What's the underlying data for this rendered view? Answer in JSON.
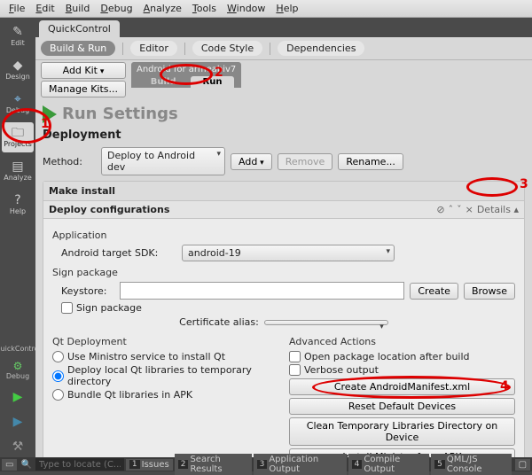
{
  "menu": [
    "File",
    "Edit",
    "Build",
    "Debug",
    "Analyze",
    "Tools",
    "Window",
    "Help"
  ],
  "sidebar": {
    "items": [
      {
        "icon": "✎",
        "label": "Edit"
      },
      {
        "icon": "◆",
        "label": "Design"
      },
      {
        "icon": "🐞",
        "label": "Debug"
      },
      {
        "icon": "🗀",
        "label": "Projects"
      },
      {
        "icon": "📊",
        "label": "Analyze"
      },
      {
        "icon": "?",
        "label": "Help"
      }
    ],
    "project_label": "QuickControl",
    "debug_label": "Debug"
  },
  "tab": "QuickControl",
  "topnav": [
    "Build & Run",
    "Editor",
    "Code Style",
    "Dependencies"
  ],
  "kit": {
    "add": "Add Kit",
    "manage": "Manage Kits...",
    "title": "Android for armeabiv7",
    "modes": [
      "Build",
      "Run"
    ]
  },
  "page_title": "Run Settings",
  "deployment": {
    "heading": "Deployment",
    "method_label": "Method:",
    "method_value": "Deploy to Android dev",
    "add": "Add",
    "remove": "Remove",
    "rename": "Rename..."
  },
  "panel": {
    "make": "Make install",
    "deploy_conf": "Deploy configurations",
    "details": "Details",
    "application": "Application",
    "target_sdk_label": "Android target SDK:",
    "target_sdk_value": "android-19",
    "sign": "Sign package",
    "keystore_label": "Keystore:",
    "create": "Create",
    "browse": "Browse",
    "sign_chk": "Sign package",
    "cert_alias": "Certificate alias:",
    "qt_deploy": "Qt Deployment",
    "qt_opts": [
      "Use Ministro service to install Qt",
      "Deploy local Qt libraries to temporary directory",
      "Bundle Qt libraries in APK"
    ],
    "adv": "Advanced Actions",
    "open_loc": "Open package location after build",
    "verbose": "Verbose output",
    "btns": [
      "Create AndroidManifest.xml",
      "Reset Default Devices",
      "Clean Temporary Libraries Directory on Device",
      "Install Ministro from APK"
    ]
  },
  "status": {
    "search_ph": "Type to locate (C...",
    "tabs": [
      "Issues",
      "Search Results",
      "Application Output",
      "Compile Output",
      "QML/JS Console"
    ]
  },
  "annotations": [
    "1",
    "2",
    "3",
    "4"
  ]
}
